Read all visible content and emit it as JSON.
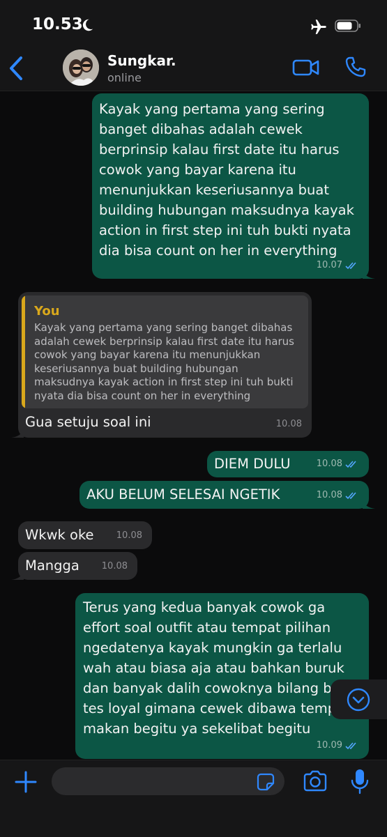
{
  "status": {
    "time": "10.53",
    "icons": [
      "moon-icon",
      "airplane-icon",
      "battery-icon"
    ]
  },
  "header": {
    "name": "Sungkar.",
    "status": "online",
    "icons": [
      "back-icon",
      "video-call-icon",
      "phone-icon"
    ]
  },
  "colors": {
    "accent": "#2f88ff",
    "outgoing": "#0c5645",
    "incoming": "#2a2a2c",
    "quote": "#d9a81c",
    "background": "#0b0b0c"
  },
  "messages": [
    {
      "dir": "out",
      "time": "10.07",
      "read": true,
      "lines": [
        "Kayak yang pertama yang sering",
        "banget dibahas adalah cewek",
        "berprinsip kalau first date itu harus",
        "cowok yang bayar karena itu",
        "menunjukkan keseriusannya buat",
        "building hubungan maksudnya kayak",
        "action in first step ini tuh bukti nyata",
        "dia bisa count on her in everything"
      ]
    },
    {
      "dir": "in",
      "time": "10.08",
      "text": "Gua setuju soal ini",
      "quote": {
        "author": "You",
        "lines": [
          "Kayak yang pertama yang sering banget dibahas",
          "adalah cewek berprinsip kalau first date itu harus",
          "cowok yang bayar karena itu menunjukkan",
          "keseriusannya buat building hubungan",
          "maksudnya kayak action in first step ini tuh bukti",
          "nyata dia bisa count on her in everything"
        ]
      }
    },
    {
      "dir": "out",
      "time": "10.08",
      "read": true,
      "text": "DIEM DULU"
    },
    {
      "dir": "out",
      "time": "10.08",
      "read": true,
      "text": "AKU BELUM SELESAI NGETIK"
    },
    {
      "dir": "in",
      "time": "10.08",
      "text": "Wkwk oke"
    },
    {
      "dir": "in",
      "time": "10.08",
      "text": "Mangga"
    },
    {
      "dir": "out",
      "time": "10.09",
      "read": true,
      "lines": [
        "Terus yang kedua banyak cowok ga",
        "effort soal outfit atau tempat pilihan",
        "ngedatenya kayak mungkin ga terlalu",
        "wah atau biasa aja atau bahkan buruk",
        "dan banyak dalih cowoknya bilang b",
        "tes loyal gimana cewek dibawa temp",
        "makan begitu ya sekelibat begitu"
      ]
    }
  ],
  "composer": {
    "placeholder": "",
    "icons": [
      "plus-icon",
      "sticker-icon",
      "camera-icon",
      "mic-icon"
    ]
  },
  "scroll_down": {
    "icon": "chevron-down-icon"
  }
}
